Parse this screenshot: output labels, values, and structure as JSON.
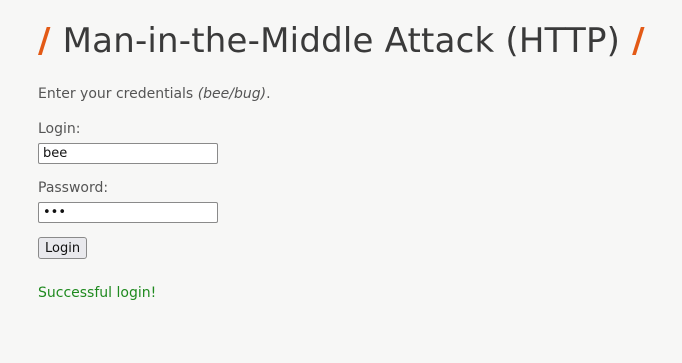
{
  "header": {
    "slash_left": "/",
    "title": "Man-in-the-Middle Attack (HTTP)",
    "slash_right": "/",
    "accent_color": "#e35a16"
  },
  "intro": {
    "text": "Enter your credentials ",
    "hint": "(bee/bug)",
    "suffix": "."
  },
  "form": {
    "login_label": "Login:",
    "login_value": "bee",
    "password_label": "Password:",
    "password_value": "bug",
    "submit_label": "Login"
  },
  "status": {
    "message": "Successful login!",
    "color": "#1f8a1f"
  }
}
